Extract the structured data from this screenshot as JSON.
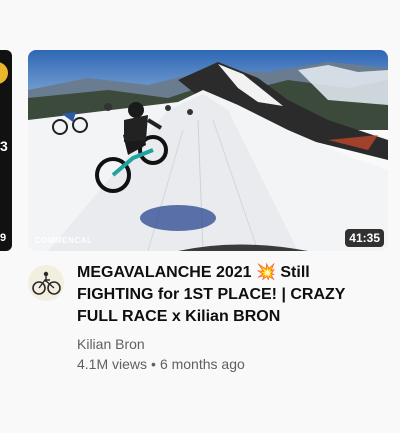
{
  "prev_card": {
    "char": "3",
    "time": "9"
  },
  "video": {
    "duration": "41:35",
    "watermark": "COMMENCAL",
    "title": "MEGAVALANCHE 2021 💥 Still FIGHTING for 1ST PLACE! | CRAZY FULL RACE x Kilian BRON",
    "channel": "Kilian Bron",
    "views": "4.1M views",
    "separator": "•",
    "age": "6 months ago"
  }
}
